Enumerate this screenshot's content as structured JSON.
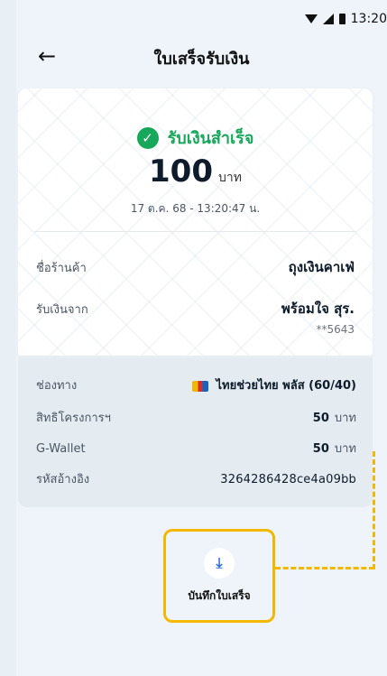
{
  "status_bar": {
    "time": "13:20"
  },
  "header": {
    "title": "ใบเสร็จรับเงิน",
    "back_icon": "arrow-left-icon"
  },
  "receipt": {
    "status_text": "รับเงินสำเร็จ",
    "amount": "100",
    "amount_unit": "บาท",
    "datetime": "17 ต.ค. 68 - 13:20:47 น.",
    "merchant_label": "ชื่อร้านค้า",
    "merchant_value": "ถุงเงินคาเฟ่",
    "from_label": "รับเงินจาก",
    "from_value": "พร้อมใจ สุร.",
    "from_account": "**5643"
  },
  "details": {
    "channel_label": "ช่องทาง",
    "channel_value": "ไทยช่วยไทย พลัส (60/40)",
    "entitlement_label": "สิทธิโครงการฯ",
    "entitlement_value": "50",
    "entitlement_unit": "บาท",
    "gwallet_label": "G-Wallet",
    "gwallet_value": "50",
    "gwallet_unit": "บาท",
    "ref_label": "รหัสอ้างอิง",
    "ref_value": "3264286428ce4a09bb"
  },
  "actions": {
    "save_label": "บันทึกใบเสร็จ",
    "save_icon": "download-icon"
  },
  "colors": {
    "success": "#17a85b",
    "highlight": "#f5b800",
    "accent": "#2f6fdc"
  }
}
